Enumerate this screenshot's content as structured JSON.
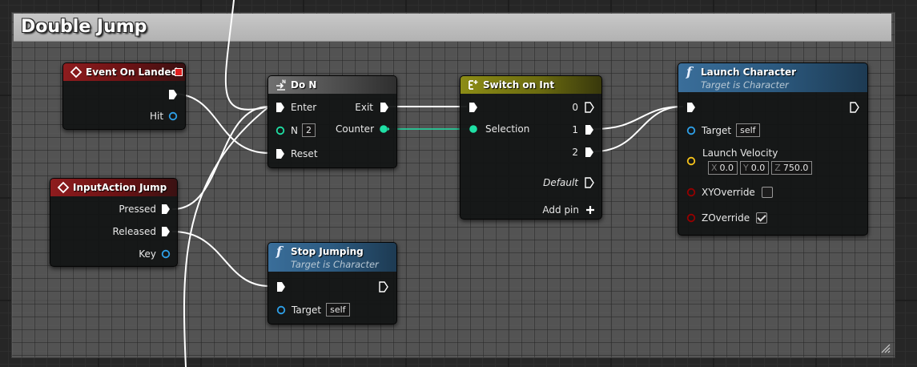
{
  "comment": {
    "title": "Double Jump"
  },
  "colors": {
    "exec": "#ffffff",
    "integer": "#1fe0a5",
    "object": "#2ea0e8",
    "vector": "#f5c21a",
    "boolean": "#950000",
    "event_header": "#8e1c1e",
    "macro_header": "#6a6a6a",
    "switch_header": "#8c8c16",
    "function_header": "#3a6e9a"
  },
  "nodes": {
    "event_on_landed": {
      "title": "Event On Landed",
      "icon": "event-diamond-icon",
      "pins": {
        "hit": "Hit"
      }
    },
    "input_action_jump": {
      "title": "InputAction Jump",
      "icon": "event-diamond-icon",
      "pins": {
        "pressed": "Pressed",
        "released": "Released",
        "key": "Key"
      }
    },
    "do_n": {
      "title": "Do N",
      "icon": "macro-icon",
      "pins": {
        "enter": "Enter",
        "n": "N",
        "n_value": "2",
        "reset": "Reset",
        "exit": "Exit",
        "counter": "Counter"
      }
    },
    "switch_on_int": {
      "title": "Switch on Int",
      "icon": "switch-icon",
      "pins": {
        "selection": "Selection",
        "out_0": "0",
        "out_1": "1",
        "out_2": "2",
        "default": "Default",
        "add_pin": "Add pin"
      }
    },
    "stop_jumping": {
      "title": "Stop Jumping",
      "subtitle": "Target is Character",
      "icon": "function-icon",
      "pins": {
        "target": "Target",
        "target_value": "self"
      }
    },
    "launch_character": {
      "title": "Launch Character",
      "subtitle": "Target is Character",
      "icon": "function-icon",
      "pins": {
        "target": "Target",
        "target_value": "self",
        "launch_velocity": "Launch Velocity",
        "x_label": "X",
        "x_value": "0.0",
        "y_label": "Y",
        "y_value": "0.0",
        "z_label": "Z",
        "z_value": "750.0",
        "xy_override": "XYOverride",
        "xy_override_checked": false,
        "z_override": "ZOverride",
        "z_override_checked": true
      }
    }
  }
}
